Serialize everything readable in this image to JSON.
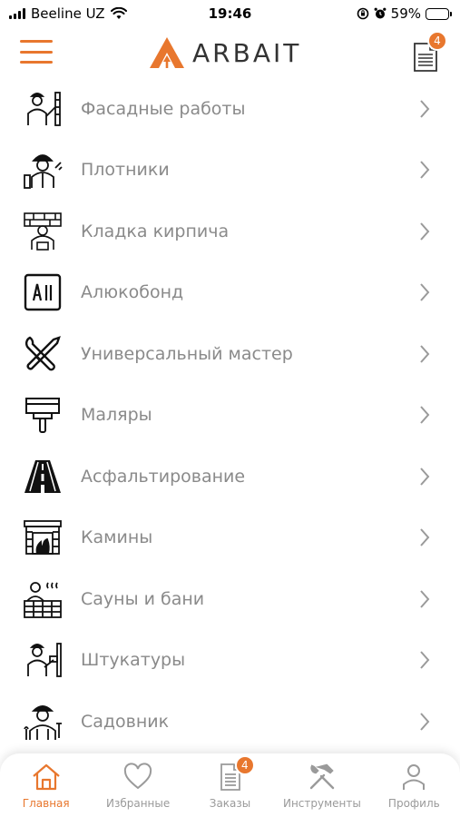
{
  "status_bar": {
    "carrier": "Beeline UZ",
    "time": "19:46",
    "battery": "59%",
    "battery_level": 0.59
  },
  "header": {
    "logo_text": "ARBAIT",
    "orders_badge": "4",
    "accent_color": "#e8772e"
  },
  "categories": [
    {
      "label": "Фасадные работы",
      "icon": "facade-worker-icon"
    },
    {
      "label": "Плотники",
      "icon": "carpenter-icon"
    },
    {
      "label": "Кладка кирпича",
      "icon": "bricklayer-icon"
    },
    {
      "label": "Алюкобонд",
      "icon": "alucobond-icon"
    },
    {
      "label": "Универсальный мастер",
      "icon": "wrench-screwdriver-icon"
    },
    {
      "label": "Маляры",
      "icon": "paint-brush-icon"
    },
    {
      "label": "Асфальтирование",
      "icon": "road-icon"
    },
    {
      "label": "Камины",
      "icon": "fireplace-icon"
    },
    {
      "label": "Сауны и бани",
      "icon": "sauna-icon"
    },
    {
      "label": "Штукатуры",
      "icon": "plasterer-icon"
    },
    {
      "label": "Садовник",
      "icon": "gardener-icon"
    }
  ],
  "tabbar": {
    "tabs": [
      {
        "label": "Главная",
        "icon": "home-icon",
        "active": true
      },
      {
        "label": "Избранные",
        "icon": "heart-icon",
        "active": false
      },
      {
        "label": "Заказы",
        "icon": "document-icon",
        "active": false,
        "badge": "4"
      },
      {
        "label": "Инструменты",
        "icon": "tools-icon",
        "active": false
      },
      {
        "label": "Профиль",
        "icon": "person-icon",
        "active": false
      }
    ]
  }
}
